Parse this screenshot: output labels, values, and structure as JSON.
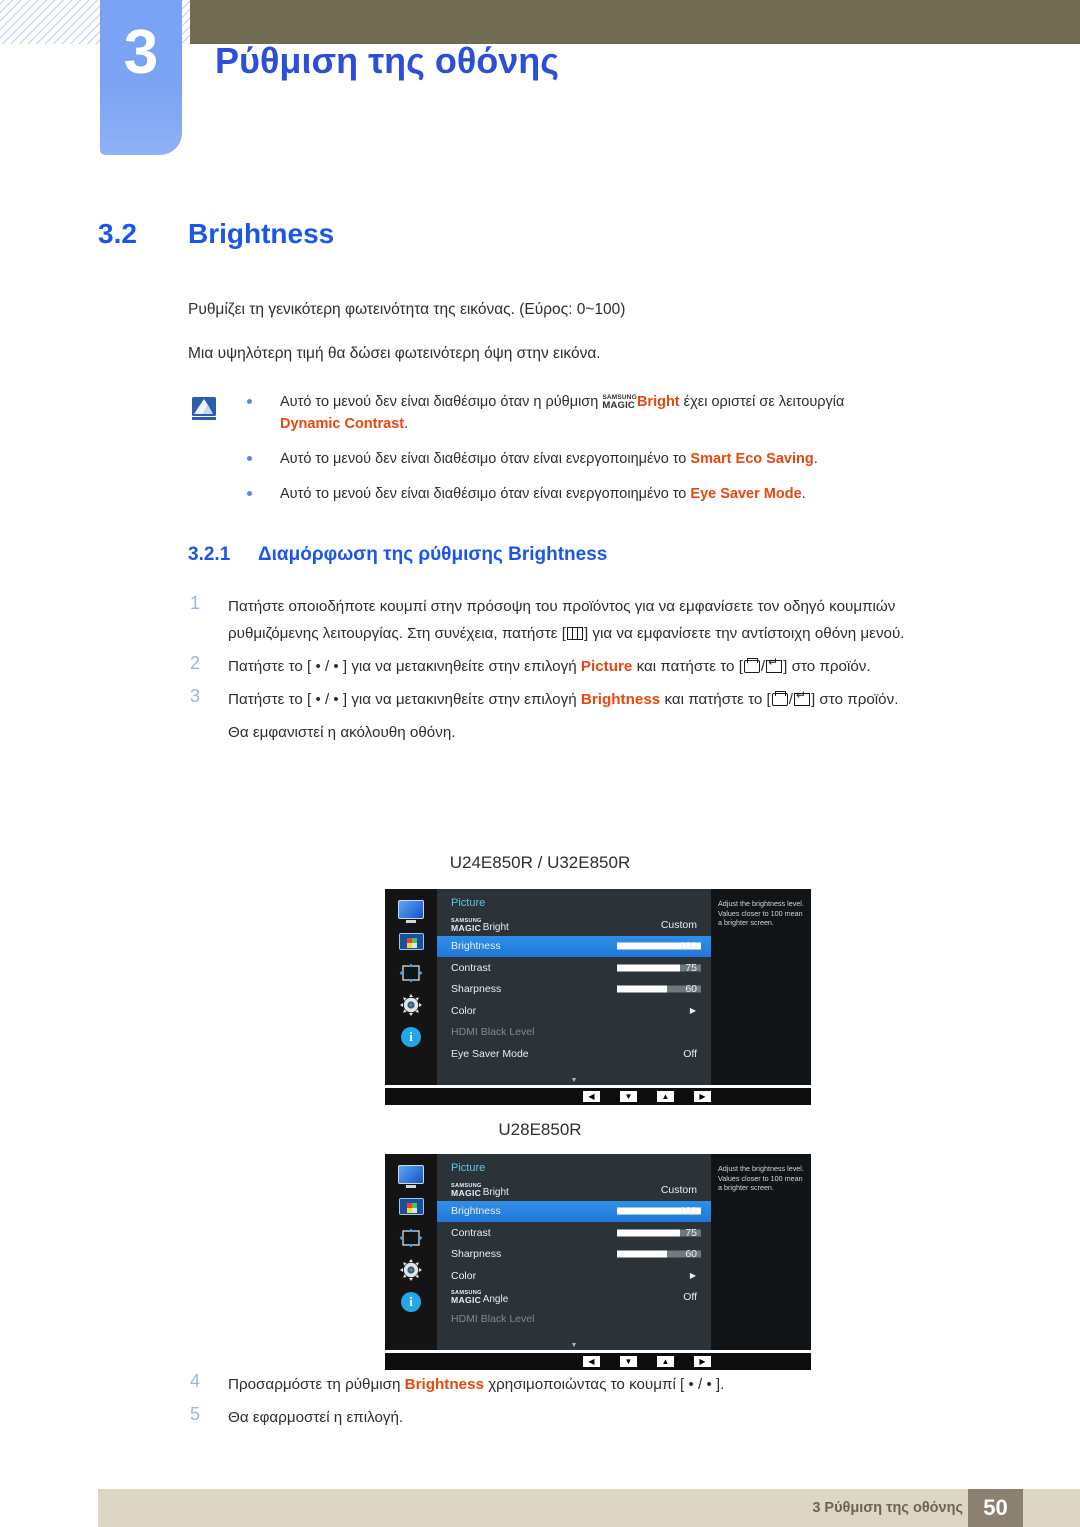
{
  "header": {
    "chapter_number": "3",
    "chapter_title": "Ρύθμιση της οθόνης"
  },
  "section": {
    "number": "3.2",
    "title": "Brightness",
    "paragraph1": "Ρυθμίζει τη γενικότερη φωτεινότητα της εικόνας. (Εύρος: 0~100)",
    "paragraph2": "Μια υψηλότερη τιμή θα δώσει φωτεινότερη όψη στην εικόνα."
  },
  "notes": {
    "note1_a": "Αυτό το μενού δεν είναι διαθέσιμο όταν η ρύθμιση ",
    "note1_magic_top": "SAMSUNG",
    "note1_magic_bottom": "MAGIC",
    "note1_magic_suffix": "Bright",
    "note1_b": " έχει οριστεί σε λειτουργία ",
    "note1_highlight": "Dynamic Contrast",
    "note1_c": ".",
    "note2_a": "Αυτό το μενού δεν είναι διαθέσιμο όταν είναι ενεργοποιημένο το ",
    "note2_highlight": "Smart Eco Saving",
    "note2_b": ".",
    "note3_a": "Αυτό το μενού δεν είναι διαθέσιμο όταν είναι ενεργοποιημένο το ",
    "note3_highlight": "Eye Saver Mode",
    "note3_b": "."
  },
  "subsection": {
    "number": "3.2.1",
    "title": "Διαμόρφωση της ρύθμισης Brightness"
  },
  "steps": {
    "s1_index": "1",
    "s1_a": "Πατήστε οποιοδήποτε κουμπί στην πρόσοψη του προϊόντος για να εμφανίσετε τον οδηγό κουμπιών ρυθμιζόμενης λειτουργίας. Στη συνέχεια, πατήστε [",
    "s1_b": "] για να εμφανίσετε την αντίστοιχη οθόνη μενού.",
    "s2_index": "2",
    "s2_a": "Πατήστε το [ ",
    "s2_b": " / ",
    "s2_c": " ] για να μετακινηθείτε στην επιλογή ",
    "s2_highlight": "Picture",
    "s2_d": " και πατήστε το [",
    "s2_e": "/",
    "s2_f": "] στο προϊόν.",
    "s3_index": "3",
    "s3_a": "Πατήστε το [ ",
    "s3_b": " / ",
    "s3_c": " ] για να μετακινηθείτε στην επιλογή ",
    "s3_highlight": "Brightness",
    "s3_d": " και πατήστε το [",
    "s3_e": "/",
    "s3_f": "] στο προϊόν.",
    "s3_note": "Θα εμφανιστεί η ακόλουθη οθόνη.",
    "s4_index": "4",
    "s4_a": "Προσαρμόστε τη ρύθμιση ",
    "s4_highlight": "Brightness",
    "s4_b": " χρησιμοποιώντας το κουμπί [ ",
    "s4_c": " / ",
    "s4_d": " ].",
    "s5_index": "5",
    "s5_text": "Θα εφαρμοστεί η επιλογή."
  },
  "osd1": {
    "caption": "U24E850R / U32E850R",
    "title": "Picture",
    "help_text": "Adjust the brightness level. Values closer to 100 mean a brighter screen.",
    "magic_top": "SAMSUNG",
    "magic_bottom": "MAGIC",
    "rows": [
      {
        "label_magic": true,
        "magic_top": "SAMSUNG",
        "magic_bottom": "MAGIC",
        "suffix": "Bright",
        "value": "Custom",
        "selected": false,
        "dim": false,
        "bar": null
      },
      {
        "label": "Brightness",
        "value": "100",
        "selected": true,
        "dim": false,
        "bar": 100
      },
      {
        "label": "Contrast",
        "value": "75",
        "selected": false,
        "dim": false,
        "bar": 75
      },
      {
        "label": "Sharpness",
        "value": "60",
        "selected": false,
        "dim": false,
        "bar": 60
      },
      {
        "label": "Color",
        "value": "",
        "arrow": "▶",
        "selected": false,
        "dim": false,
        "bar": null
      },
      {
        "label": "HDMI Black Level",
        "value": "",
        "selected": false,
        "dim": true,
        "bar": null
      },
      {
        "label": "Eye Saver Mode",
        "value": "Off",
        "selected": false,
        "dim": false,
        "bar": null
      }
    ],
    "more_glyph": "▼",
    "buttons": [
      "◀",
      "▼",
      "▲",
      "▶"
    ],
    "sidebar_icons": [
      "monitor-icon",
      "picture-icon",
      "move-icon",
      "gear-icon",
      "info-icon"
    ]
  },
  "osd2": {
    "caption": "U28E850R",
    "title": "Picture",
    "help_text": "Adjust the brightness level. Values closer to 100 mean a brighter screen.",
    "rows": [
      {
        "label_magic": true,
        "magic_top": "SAMSUNG",
        "magic_bottom": "MAGIC",
        "suffix": "Bright",
        "value": "Custom",
        "selected": false,
        "dim": false,
        "bar": null
      },
      {
        "label": "Brightness",
        "value": "100",
        "selected": true,
        "dim": false,
        "bar": 100
      },
      {
        "label": "Contrast",
        "value": "75",
        "selected": false,
        "dim": false,
        "bar": 75
      },
      {
        "label": "Sharpness",
        "value": "60",
        "selected": false,
        "dim": false,
        "bar": 60
      },
      {
        "label": "Color",
        "value": "",
        "arrow": "▶",
        "selected": false,
        "dim": false,
        "bar": null
      },
      {
        "label_magic": true,
        "magic_top": "SAMSUNG",
        "magic_bottom": "MAGIC",
        "suffix": "Angle",
        "value": "Off",
        "selected": false,
        "dim": false,
        "bar": null
      },
      {
        "label": "HDMI Black Level",
        "value": "",
        "selected": false,
        "dim": true,
        "bar": null
      }
    ],
    "more_glyph": "▼",
    "buttons": [
      "◀",
      "▼",
      "▲",
      "▶"
    ],
    "sidebar_icons": [
      "monitor-icon",
      "picture-icon",
      "move-icon",
      "gear-icon",
      "info-icon"
    ]
  },
  "footer": {
    "text": "3 Ρύθμιση της οθόνης",
    "page": "50"
  },
  "colors": {
    "accent_blue": "#1a56e8",
    "highlight_red": "#e8470f",
    "header_olive": "#706b51",
    "tab_blue": "#7ba3f3",
    "footer_bar": "#ddd6c5",
    "footer_page": "#8c8170",
    "osd_selected": "#2278d8"
  }
}
